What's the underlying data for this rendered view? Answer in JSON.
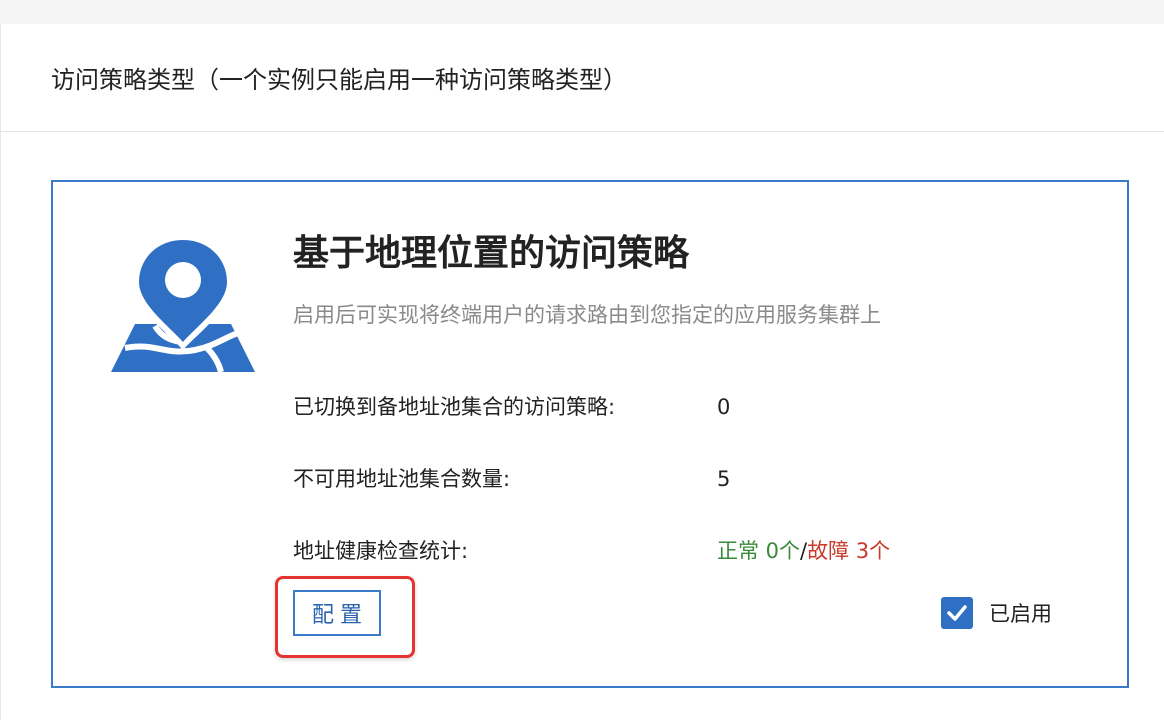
{
  "section": {
    "title": "访问策略类型（一个实例只能启用一种访问策略类型）"
  },
  "card": {
    "icon": "map-pin-icon",
    "title": "基于地理位置的访问策略",
    "description": "启用后可实现将终端用户的请求路由到您指定的应用服务集群上",
    "stats": [
      {
        "label": "已切换到备地址池集合的访问策略:",
        "value": "0"
      },
      {
        "label": "不可用地址池集合数量:",
        "value": "5"
      },
      {
        "label": "地址健康检查统计:",
        "ok": "正常 0个",
        "separator": "/",
        "fail": "故障 3个"
      }
    ],
    "config_label": "配置",
    "enabled_label": "已启用",
    "enabled_checked": true
  },
  "colors": {
    "accent": "#3a78c9",
    "ok": "#3a8a3a",
    "fail": "#c8382b",
    "highlight": "#e3342f"
  }
}
